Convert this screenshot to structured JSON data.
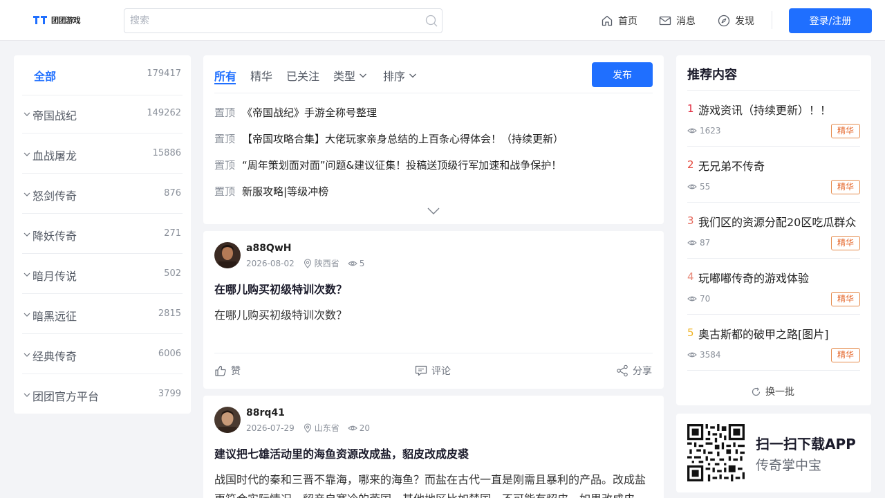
{
  "header": {
    "logo_text": "团团游戏",
    "search_placeholder": "搜索",
    "nav": [
      {
        "label": "首页",
        "icon": "home-icon"
      },
      {
        "label": "消息",
        "icon": "mail-icon"
      },
      {
        "label": "发现",
        "icon": "compass-icon"
      }
    ],
    "login_label": "登录/注册"
  },
  "sidebar": {
    "categories": [
      {
        "name": "全部",
        "count": "179417"
      },
      {
        "name": "帝国战纪",
        "count": "149262"
      },
      {
        "name": "血战屠龙",
        "count": "15886"
      },
      {
        "name": "怒剑传奇",
        "count": "876"
      },
      {
        "name": "降妖传奇",
        "count": "271"
      },
      {
        "name": "暗月传说",
        "count": "502"
      },
      {
        "name": "暗黑远征",
        "count": "2815"
      },
      {
        "name": "经典传奇",
        "count": "6006"
      },
      {
        "name": "团团官方平台",
        "count": "3799"
      }
    ]
  },
  "feed": {
    "tabs": [
      {
        "label": "所有"
      },
      {
        "label": "精华"
      },
      {
        "label": "已关注"
      },
      {
        "label": "类型"
      },
      {
        "label": "排序"
      }
    ],
    "publish_label": "发布",
    "pinned_tag": "置顶",
    "pinned": [
      "《帝国战纪》手游全称号整理",
      "【帝国攻略合集】大佬玩家亲身总结的上百条心得体会！（持续更新）",
      "“周年策划面对面”问题&建议征集！投稿送顶级行军加速和战争保护！",
      "新服攻略|等级冲榜"
    ],
    "posts": [
      {
        "author": "a88QwH",
        "date": "2026-08-02",
        "location": "陕西省",
        "views": "5",
        "title": "在哪儿购买初级特训次数？",
        "body": "在哪儿购买初级特训次数？"
      },
      {
        "author": "88rq41",
        "date": "2026-07-29",
        "location": "山东省",
        "views": "20",
        "title": "建议把七雄活动里的海鱼资源改成盐，貂皮改成皮裘",
        "body": "战国时代的秦和三晋不靠海，哪来的海鱼？而盐在古代一直是刚需且暴利的产品。改成盐更符合实际情况。貂产自寒冷的燕国，其他地区比如楚国，不可能有貂皮，如果改成皮"
      }
    ],
    "actions": {
      "like": "赞",
      "comment": "评论",
      "share": "分享"
    }
  },
  "recommend": {
    "title": "推荐内容",
    "badge": "精华",
    "rank_colors": [
      "#e0283c",
      "#e5483c",
      "#e5675a",
      "#e88a7a",
      "#f0b323"
    ],
    "items": [
      {
        "rank": "1",
        "title": "游戏资讯（持续更新）！！",
        "views": "1623"
      },
      {
        "rank": "2",
        "title": "无兄弟不传奇",
        "views": "55"
      },
      {
        "rank": "3",
        "title": "我们区的资源分配20区吃瓜群众",
        "views": "87"
      },
      {
        "rank": "4",
        "title": "玩嘟嘟传奇的游戏体验",
        "views": "70"
      },
      {
        "rank": "5",
        "title": "奥古斯都的破甲之路[图片]",
        "views": "3584"
      }
    ],
    "refresh_label": "换一批"
  },
  "app": {
    "title": "扫一扫下载APP",
    "subtitle": "传奇掌中宝"
  }
}
